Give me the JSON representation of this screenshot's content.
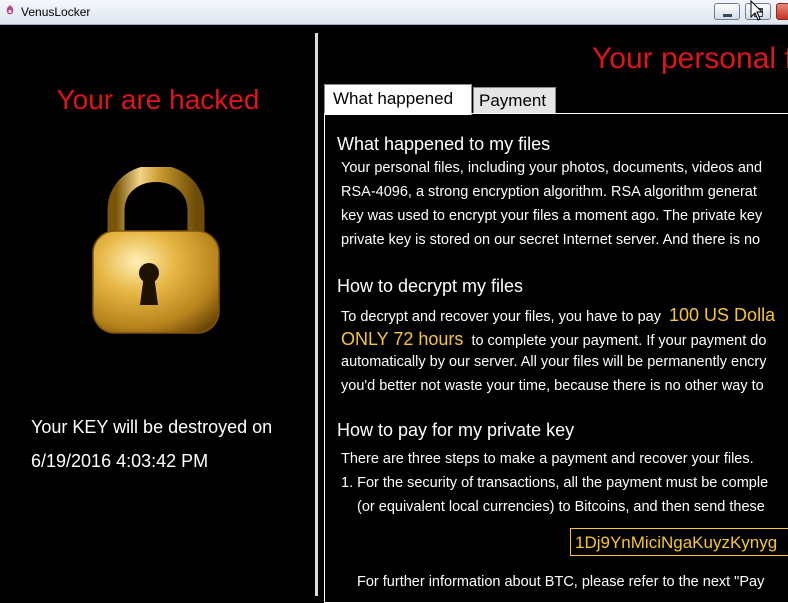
{
  "window": {
    "title": "VenusLocker"
  },
  "left_panel": {
    "hacked_text": "Your are hacked",
    "key_destroy_text": "Your KEY will be destroyed on",
    "deadline": "6/19/2016 4:03:42 PM",
    "lock_icon": "padlock-icon"
  },
  "right_panel": {
    "headline": "Your personal f",
    "tabs": [
      {
        "label": "What happened",
        "active": true
      },
      {
        "label": "Payment",
        "active": false
      }
    ],
    "sections": {
      "what_happened": {
        "title": "What happened to my files",
        "lines": [
          "Your personal files, including your photos, documents, videos and",
          "RSA-4096, a strong encryption algorithm. RSA algorithm generat",
          "key was used to encrypt your files a moment ago. The private key",
          "private key is stored on our secret Internet server. And there is no"
        ]
      },
      "how_to_decrypt": {
        "title": "How to decrypt my files",
        "line1_prefix": "To decrypt and recover your files, you have to pay",
        "amount": "100 US Dolla",
        "time_limit": "ONLY 72 hours",
        "line2_suffix": "to complete your payment. If your payment do",
        "line3": "automatically by our server. All your files will be permanently encry",
        "line4": "you'd better not waste your time, because there is no other way to"
      },
      "how_to_pay": {
        "title": "How to pay for my private key",
        "intro": "There are three steps to make a payment and recover your files.",
        "step1_line1": "1. For the security of transactions, all the payment must be comple",
        "step1_line2": "(or equivalent local currencies) to Bitcoins, and then send these",
        "btc_address": "1Dj9YnMiciNgaKuyzKynyg",
        "further_info": "For further information about BTC, please refer to the next \"Pay"
      }
    }
  },
  "colors": {
    "alert_red": "#e0141b",
    "highlight_yellow": "#f7c631",
    "background": "#000000"
  }
}
